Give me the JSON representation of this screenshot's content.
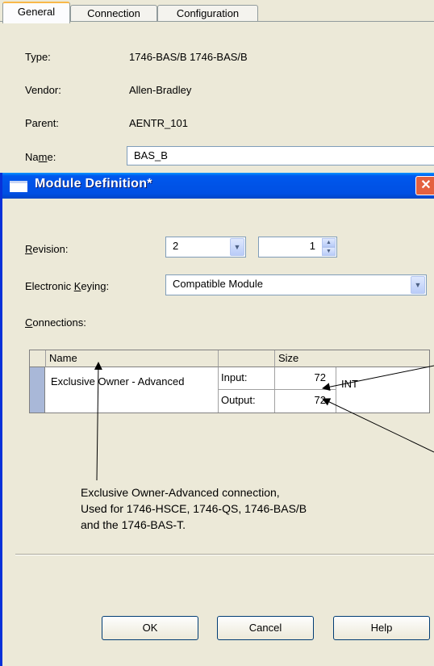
{
  "tabs": [
    "General",
    "Connection",
    "Configuration"
  ],
  "general": {
    "type_label": "Type:",
    "type_value": "1746-BAS/B 1746-BAS/B",
    "vendor_label": "Vendor:",
    "vendor_value": "Allen-Bradley",
    "parent_label": "Parent:",
    "parent_value": "AENTR_101",
    "name_label_pre": "Na",
    "name_label_u": "m",
    "name_label_post": "e:",
    "name_value": "BAS_B"
  },
  "dialog": {
    "title": "Module Definition*",
    "close_glyph": "✕",
    "revision_label_u": "R",
    "revision_label_post": "evision:",
    "revision_major": "2",
    "revision_minor": "1",
    "keying_label_pre": "Electronic ",
    "keying_label_u": "K",
    "keying_label_post": "eying:",
    "keying_value": "Compatible Module",
    "connections_label_u": "C",
    "connections_label_post": "onnections:",
    "grid": {
      "headers": [
        "Name",
        "",
        "Size"
      ],
      "row": {
        "name": "Exclusive Owner - Advanced",
        "input_label": "Input:",
        "input_size": "72",
        "output_label": "Output:",
        "output_size": "72",
        "data_type": "INT"
      }
    },
    "buttons": {
      "ok": "OK",
      "cancel": "Cancel",
      "help": "Help"
    }
  },
  "annotation": {
    "line1": "Exclusive Owner-Advanced connection,",
    "line2": "Used for 1746-HSCE, 1746-QS, 1746-BAS/B",
    "line3": "and the 1746-BAS-T."
  },
  "colors": {
    "titlebar": "#0053e7",
    "close": "#e4613f",
    "dialog_bg": "#ece9d8",
    "selector": "#a9b8d8"
  }
}
